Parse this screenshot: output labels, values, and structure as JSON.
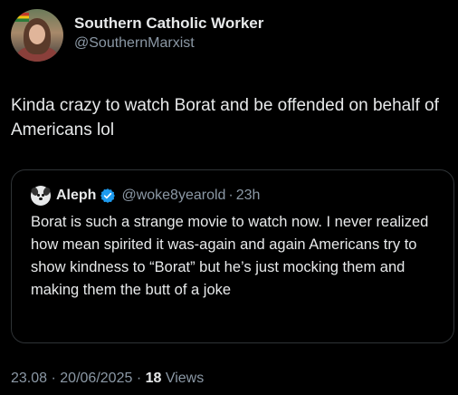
{
  "author": {
    "display_name": "Southern Catholic Worker",
    "handle": "@SouthernMarxist"
  },
  "tweet": {
    "text": "Kinda crazy to watch Borat and be offended on behalf of Americans lol"
  },
  "quoted": {
    "display_name": "Aleph",
    "handle": "@woke8yearold",
    "separator": "·",
    "time": "23h",
    "verified_icon": "verified-badge-icon",
    "text": "Borat is such a strange movie to watch now. I never realized how mean spirited it was-again and again Americans try to show kindness to “Borat” but he’s just mocking them and making them the butt of a joke"
  },
  "meta": {
    "time": "23.08",
    "separator": "·",
    "date": "20/06/2025",
    "separator2": "·",
    "views_count": "18",
    "views_label": "Views"
  },
  "colors": {
    "background": "#000000",
    "text": "#e7e9ea",
    "muted": "#8b98a5",
    "verified": "#1d9bf0",
    "border": "#2f3336"
  }
}
